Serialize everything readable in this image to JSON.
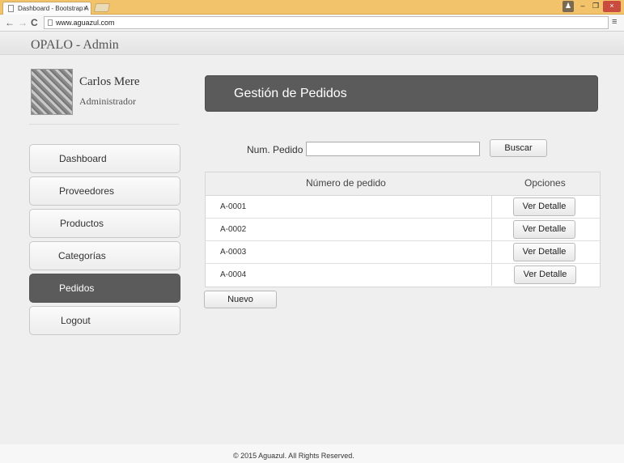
{
  "browser": {
    "tab_title": "Dashboard - Bootstrap A",
    "tab_close": "×",
    "address": "www.aguazul.com",
    "back": "←",
    "forward": "→",
    "reload": "C",
    "menu": "≡",
    "win_user": "♟",
    "win_min": "–",
    "win_max": "❐",
    "win_close": "×"
  },
  "header": {
    "brand": "OPALO - Admin"
  },
  "user": {
    "name": "Carlos Mere",
    "role": "Administrador"
  },
  "sidebar": {
    "items": [
      {
        "label": "Dashboard"
      },
      {
        "label": "Proveedores"
      },
      {
        "label": "Productos"
      },
      {
        "label": "Categorías"
      },
      {
        "label": "Pedidos"
      },
      {
        "label": "Logout"
      }
    ],
    "active_index": 4
  },
  "panel": {
    "title": "Gestión de Pedidos"
  },
  "search": {
    "label": "Num. Pedido",
    "value": "",
    "button": "Buscar"
  },
  "table": {
    "headers": [
      "Número de pedido",
      "Opciones"
    ],
    "rows": [
      {
        "id": "A-0001",
        "action": "Ver Detalle"
      },
      {
        "id": "A-0002",
        "action": "Ver Detalle"
      },
      {
        "id": "A-0003",
        "action": "Ver Detalle"
      },
      {
        "id": "A-0004",
        "action": "Ver Detalle"
      }
    ]
  },
  "new_button": "Nuevo",
  "footer": "© 2015 Aguazul. All Rights Reserved.",
  "colors": {
    "accent_dark": "#5b5b5b",
    "tabbar": "#f2c36b",
    "background": "#efefef"
  }
}
